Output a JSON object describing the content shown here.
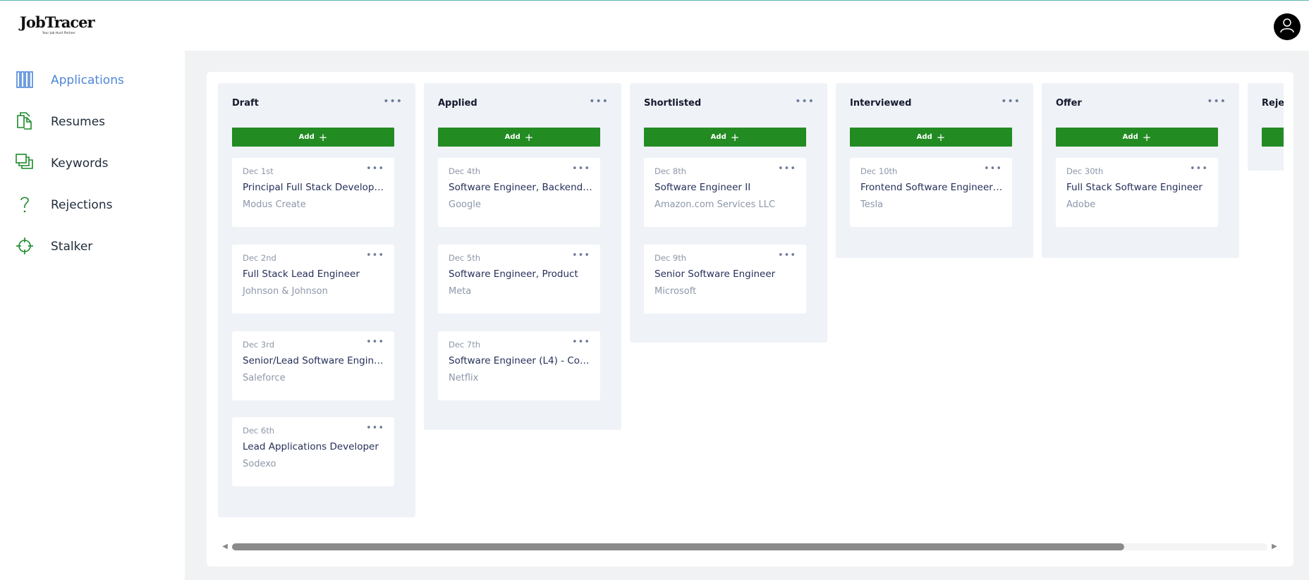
{
  "app": {
    "logo_text": "JobTracer",
    "logo_tagline": "Your Job Hunt Partner"
  },
  "sidebar": {
    "items": [
      {
        "label": "Applications",
        "icon": "columns-icon",
        "active": true
      },
      {
        "label": "Resumes",
        "icon": "documents-icon",
        "active": false
      },
      {
        "label": "Keywords",
        "icon": "stack-icon",
        "active": false
      },
      {
        "label": "Rejections",
        "icon": "question-icon",
        "active": false
      },
      {
        "label": "Stalker",
        "icon": "crosshair-icon",
        "active": false
      }
    ]
  },
  "header": {
    "avatar_icon": "user-icon"
  },
  "board": {
    "add_label": "Add",
    "columns": [
      {
        "title": "Draft",
        "cards": [
          {
            "date": "Dec 1st",
            "title": "Principal Full Stack Developer...",
            "company": "Modus Create"
          },
          {
            "date": "Dec 2nd",
            "title": "Full Stack Lead Engineer",
            "company": "Johnson & Johnson"
          },
          {
            "date": "Dec 3rd",
            "title": "Senior/Lead Software Engineer",
            "company": "Saleforce"
          },
          {
            "date": "Dec 6th",
            "title": "Lead Applications Developer",
            "company": "Sodexo"
          }
        ]
      },
      {
        "title": "Applied",
        "cards": [
          {
            "date": "Dec 4th",
            "title": "Software Engineer, Backend, ...",
            "company": "Google"
          },
          {
            "date": "Dec 5th",
            "title": "Software Engineer, Product",
            "company": "Meta"
          },
          {
            "date": "Dec 7th",
            "title": "Software Engineer (L4) - Cons...",
            "company": "Netflix"
          }
        ]
      },
      {
        "title": "Shortlisted",
        "cards": [
          {
            "date": "Dec 8th",
            "title": "Software Engineer II",
            "company": "Amazon.com Services LLC"
          },
          {
            "date": "Dec 9th",
            "title": "Senior Software Engineer",
            "company": "Microsoft"
          }
        ]
      },
      {
        "title": "Interviewed",
        "cards": [
          {
            "date": "Dec 10th",
            "title": "Frontend Software Engineer, ...",
            "company": "Tesla"
          }
        ]
      },
      {
        "title": "Offer",
        "cards": [
          {
            "date": "Dec 30th",
            "title": "Full Stack Software Engineer",
            "company": "Adobe"
          }
        ]
      },
      {
        "title": "Rejec",
        "cards": []
      }
    ]
  },
  "colors": {
    "accent_blue": "#4e86d9",
    "add_button_green": "#228b22",
    "nav_icon_green": "#1a8a2a",
    "column_bg": "#eff2f7"
  }
}
